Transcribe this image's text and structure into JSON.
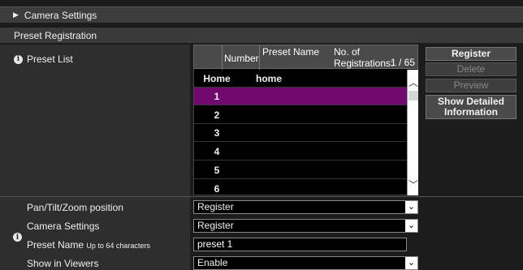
{
  "sections": {
    "camera_settings": "Camera Settings",
    "preset_registration": "Preset Registration"
  },
  "preset_list": {
    "label": "Preset List",
    "headers": {
      "number": "Number",
      "preset_name": "Preset Name",
      "registrations": "No. of Registrations:",
      "registrations_count": "1 / 65"
    },
    "rows": [
      {
        "number": "Home",
        "name": "home"
      },
      {
        "number": "1",
        "name": ""
      },
      {
        "number": "2",
        "name": ""
      },
      {
        "number": "3",
        "name": ""
      },
      {
        "number": "4",
        "name": ""
      },
      {
        "number": "5",
        "name": ""
      },
      {
        "number": "6",
        "name": ""
      }
    ]
  },
  "buttons": {
    "register": "Register",
    "delete": "Delete",
    "preview": "Preview",
    "show_detail_1": "Show Detailed",
    "show_detail_2": "Information"
  },
  "fields": {
    "ptz_label": "Pan/Tilt/Zoom position",
    "ptz_value": "Register",
    "camera_settings_label": "Camera Settings",
    "camera_settings_value": "Register",
    "preset_name_label": "Preset Name",
    "preset_name_hint": "Up to 64 characters",
    "preset_name_value": "preset 1",
    "show_viewers_label": "Show in Viewers",
    "show_viewers_value": "Enable"
  },
  "colors": {
    "selected_row": "#700a6e",
    "background": "#1c1c1c"
  },
  "icons": {
    "section_toggle": "triangle-right-icon",
    "info": "info-icon",
    "dropdown": "chevron-down-icon",
    "scroll_up": "chevron-up-icon",
    "scroll_down": "chevron-down-icon"
  }
}
